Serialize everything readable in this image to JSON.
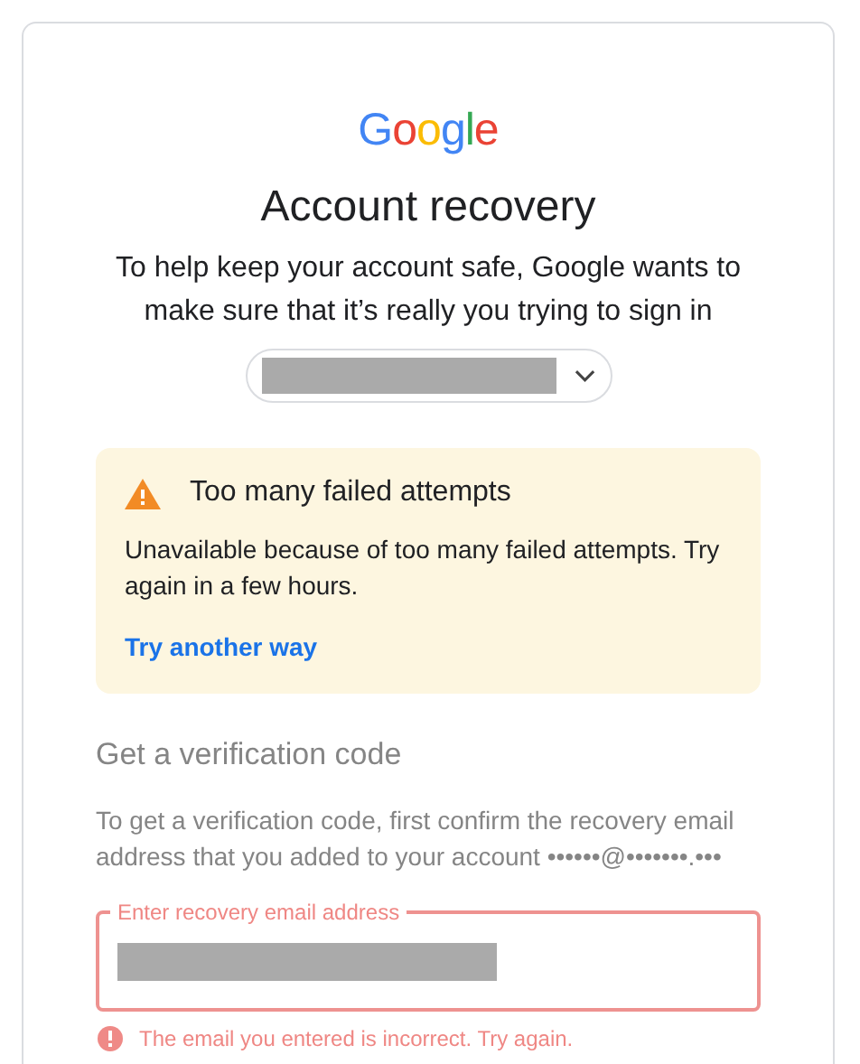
{
  "logo": "Google",
  "title": "Account recovery",
  "subtitle": "To help keep your account safe, Google wants to make sure that it’s really you trying to sign in",
  "account_chip": {
    "expanded": false
  },
  "alert": {
    "title": "Too many failed attempts",
    "message": "Unavailable because of too many failed attempts. Try again in a few hours.",
    "link": "Try another way"
  },
  "verification": {
    "heading": "Get a verification code",
    "description": "To get a verification code, first confirm the recovery email address that you added to your account ••••••@•••••••.•••",
    "disabled": true,
    "field": {
      "label": "Enter recovery email address",
      "invalid": true
    },
    "error": "The email you entered is incorrect. Try again."
  }
}
